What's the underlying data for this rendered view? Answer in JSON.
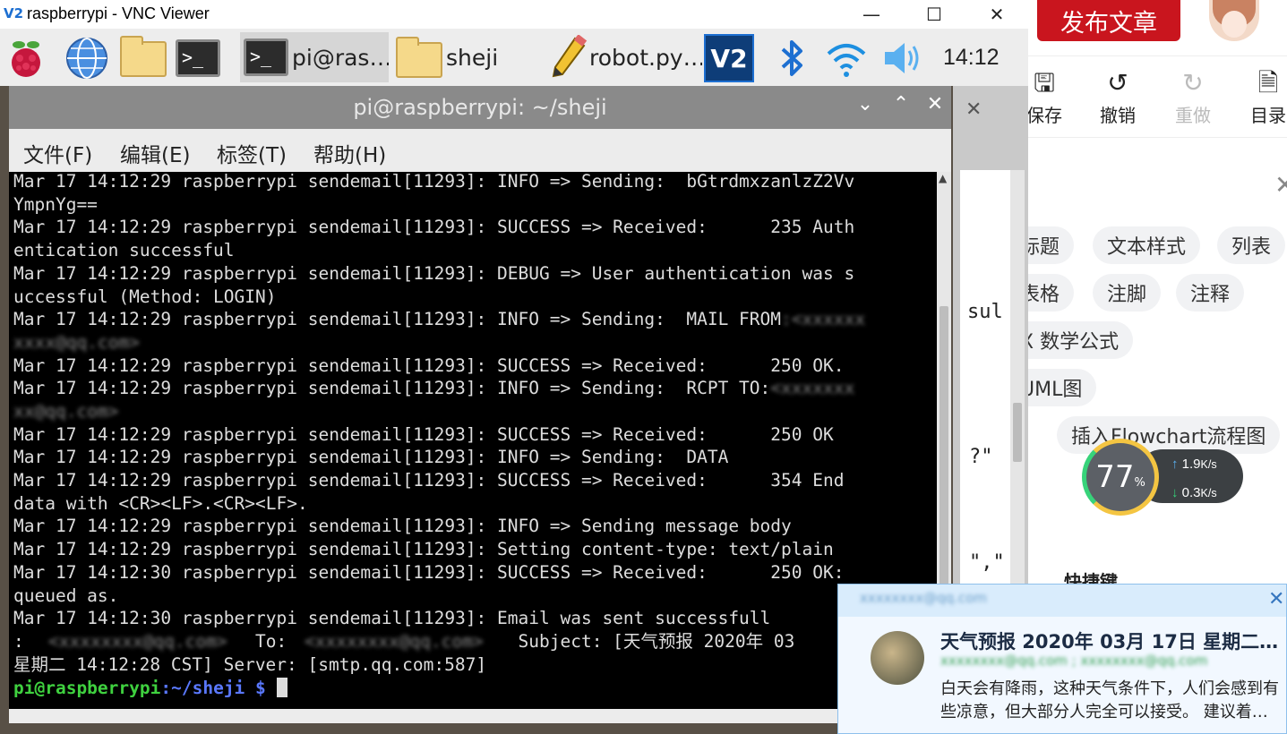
{
  "vnc": {
    "title": "raspberrypi - VNC Viewer",
    "logo": "V2",
    "controls": [
      "minimize-icon",
      "maximize-icon",
      "close-icon"
    ]
  },
  "taskbar": {
    "tasks": [
      {
        "label": "pi@ras…",
        "icon": "terminal-icon"
      },
      {
        "label": "sheji",
        "icon": "folder-icon"
      },
      {
        "label": "robot.py…",
        "icon": "pencil-icon"
      }
    ],
    "clock": "14:12"
  },
  "terminal": {
    "title": "pi@raspberrypi: ~/sheji",
    "menu": [
      "文件(F)",
      "编辑(E)",
      "标签(T)",
      "帮助(H)"
    ],
    "lines": [
      "Mar 17 14:12:29 raspberrypi sendemail[11293]: INFO => Sending:  bGtrdmxzanlzZ2Vv",
      "YmpnYg==",
      "Mar 17 14:12:29 raspberrypi sendemail[11293]: SUCCESS => Received:      235 Auth",
      "entication successful",
      "Mar 17 14:12:29 raspberrypi sendemail[11293]: DEBUG => User authentication was s",
      "uccessful (Method: LOGIN)",
      "Mar 17 14:12:29 raspberrypi sendemail[11293]: INFO => Sending:  MAIL FROM",
      "",
      "Mar 17 14:12:29 raspberrypi sendemail[11293]: SUCCESS => Received:      250 OK.",
      "Mar 17 14:12:29 raspberrypi sendemail[11293]: INFO => Sending:  RCPT TO:",
      "",
      "Mar 17 14:12:29 raspberrypi sendemail[11293]: SUCCESS => Received:      250 OK",
      "Mar 17 14:12:29 raspberrypi sendemail[11293]: INFO => Sending:  DATA",
      "Mar 17 14:12:29 raspberrypi sendemail[11293]: SUCCESS => Received:      354 End",
      "data with <CR><LF>.<CR><LF>.",
      "Mar 17 14:12:29 raspberrypi sendemail[11293]: INFO => Sending message body",
      "Mar 17 14:12:29 raspberrypi sendemail[11293]: Setting content-type: text/plain",
      "Mar 17 14:12:30 raspberrypi sendemail[11293]: SUCCESS => Received:      250 OK:",
      "queued as.",
      "Mar 17 14:12:30 raspberrypi sendemail[11293]: Email was sent successfull",
      ":                      To:                      Subject: [天气预报 2020年 03",
      "星期二 14:12:28 CST] Server: [smtp.qq.com:587]"
    ],
    "prompt_user": "pi@raspberrypi",
    "prompt_path": ":~/sheji $ "
  },
  "behind_panel": {
    "fragments": [
      "sul",
      "?\"",
      "\",\""
    ]
  },
  "editor": {
    "publish_label": "发布文章",
    "tools": [
      {
        "label": "保存",
        "icon": "save-icon"
      },
      {
        "label": "撤销",
        "icon": "undo-icon"
      },
      {
        "label": "重做",
        "icon": "redo-icon"
      },
      {
        "label": "目录",
        "icon": "outline-icon"
      }
    ],
    "chips": [
      "标题",
      "文本样式",
      "列表",
      "表格",
      "注脚",
      "注释",
      "X 数学公式",
      "UML图",
      "插入Flowchart流程图"
    ],
    "shortcut_heading": "快捷键"
  },
  "speed_widget": {
    "percent": "77",
    "unit": "%",
    "up": "1.9",
    "down": "0.3",
    "rate_unit": "K/s"
  },
  "notification": {
    "title": "天气预报 2020年 03月 17日 星期二…",
    "body": "白天会有降雨，这种天气条件下，人们会感到有些凉意，但大部分人完全可以接受。 建议着…"
  },
  "colors": {
    "publish": "#c9151e",
    "prompt_user": "#3fd13f",
    "prompt_path": "#5a78ff",
    "vnc_accent": "#1d6fd1"
  }
}
